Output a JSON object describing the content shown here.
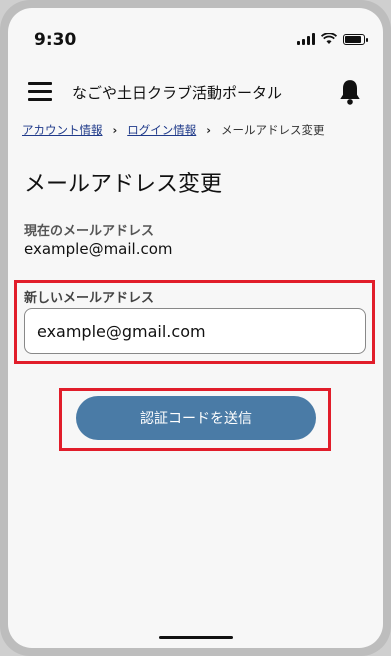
{
  "status_bar": {
    "time": "9:30"
  },
  "header": {
    "title": "なごや土日クラブ活動ポータル"
  },
  "breadcrumb": {
    "items": [
      "アカウント情報",
      "ログイン情報",
      "メールアドレス変更"
    ]
  },
  "page": {
    "title": "メールアドレス変更",
    "current_email_label": "現在のメールアドレス",
    "current_email_value": "example@mail.com",
    "new_email_label": "新しいメールアドレス",
    "new_email_value": "example@gmail.com",
    "send_button_label": "認証コードを送信"
  },
  "colors": {
    "button": "#4a7ba6",
    "highlight": "#e11d2a",
    "link": "#1f3a8a"
  },
  "icons": [
    "menu-icon",
    "bell-icon",
    "signal-icon",
    "wifi-icon",
    "battery-icon"
  ]
}
